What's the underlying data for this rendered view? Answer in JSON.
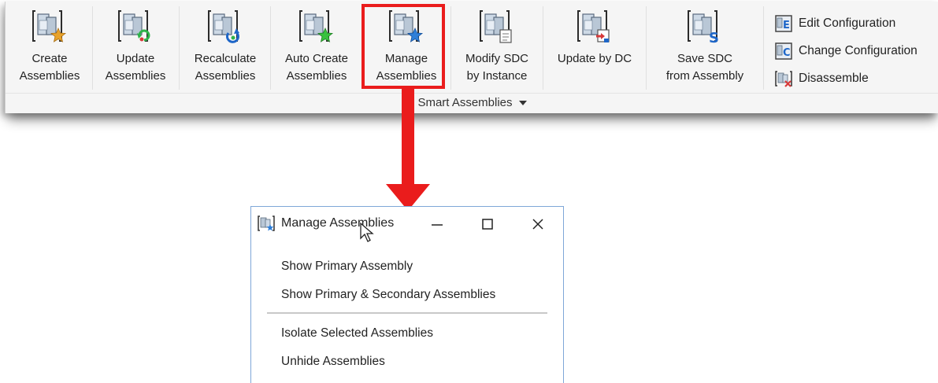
{
  "ribbon": {
    "buttons": [
      {
        "id": "create",
        "label": "Create\nAssemblies",
        "overlay_icon": "star-icon",
        "overlay_color": "#e8a22a"
      },
      {
        "id": "update",
        "label": "Update\nAssemblies",
        "overlay_icon": "refresh-icon",
        "overlay_color": "#2fb34a"
      },
      {
        "id": "recalculate",
        "label": "Recalculate\nAssemblies",
        "overlay_icon": "recalculate-icon",
        "overlay_color": "#1e66c8"
      },
      {
        "id": "auto-create",
        "label": "Auto Create\nAssemblies",
        "overlay_icon": "star-icon",
        "overlay_color": "#39c23e"
      },
      {
        "id": "manage",
        "label": "Manage\nAssemblies",
        "overlay_icon": "star-icon",
        "overlay_color": "#2f7fd8"
      },
      {
        "id": "modify-sdc",
        "label": "Modify SDC\nby Instance",
        "overlay_icon": "document-icon",
        "overlay_color": "#777777"
      },
      {
        "id": "update-dc",
        "label": "Update by DC",
        "overlay_icon": "update-icon",
        "overlay_color": "#d83a3a"
      },
      {
        "id": "save-sdc",
        "label": "Save SDC\nfrom Assembly",
        "overlay_icon": "letter-s-icon",
        "overlay_color": "#1e66c8"
      }
    ],
    "side_items": [
      {
        "label": "Edit Configuration",
        "icon": "edit-configuration-icon",
        "letter": "E"
      },
      {
        "label": "Change Configuration",
        "icon": "change-configuration-icon",
        "letter": "C"
      },
      {
        "label": "Disassemble",
        "icon": "disassemble-icon",
        "letter": ""
      }
    ],
    "group_label": "Smart Assemblies",
    "highlight_color": "#ea1c1c"
  },
  "popup": {
    "title": "Manage Assemblies",
    "items_group1": [
      "Show Primary Assembly",
      "Show Primary & Secondary Assemblies"
    ],
    "items_group2": [
      "Isolate Selected Assemblies",
      "Unhide Assemblies"
    ],
    "border_color": "#7ea7d8"
  },
  "arrow_color": "#ea1c1c"
}
